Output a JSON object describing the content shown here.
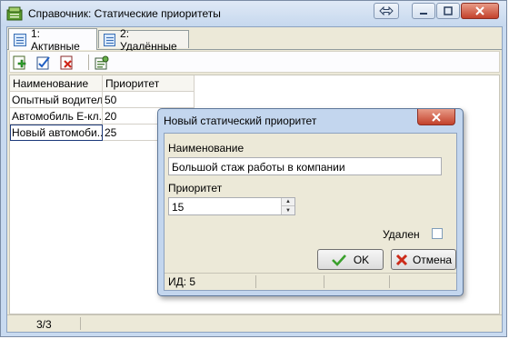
{
  "window": {
    "title": "Справочник: Статические приоритеты"
  },
  "tabs": [
    {
      "label": "1: Активные",
      "active": true
    },
    {
      "label": "2: Удалённые",
      "active": false
    }
  ],
  "toolbar": {
    "buttons": [
      "add-icon",
      "edit-icon",
      "delete-icon",
      "properties-icon"
    ]
  },
  "grid": {
    "columns": [
      "Наименование",
      "Приоритет"
    ],
    "rows": [
      {
        "name": "Опытный водитель",
        "priority": "50"
      },
      {
        "name": "Автомобиль Е-кл...",
        "priority": "20"
      },
      {
        "name": "Новый автомоби...",
        "priority": "25"
      }
    ]
  },
  "status": {
    "record_count": "3/3"
  },
  "dialog": {
    "title": "Новый статический приоритет",
    "name_label": "Наименование",
    "name_value": "Большой стаж работы в компании",
    "priority_label": "Приоритет",
    "priority_value": "15",
    "deleted_label": "Удален",
    "deleted_checked": false,
    "ok_label": "OK",
    "cancel_label": "Отмена",
    "id_text": "ИД: 5"
  },
  "colors": {
    "title_gradient_top": "#dfe9f6",
    "dialog_frame": "#c3d6ee",
    "close_button": "#c3412b",
    "ok_check": "#3aa02c",
    "cancel_x": "#cc2b1a"
  }
}
